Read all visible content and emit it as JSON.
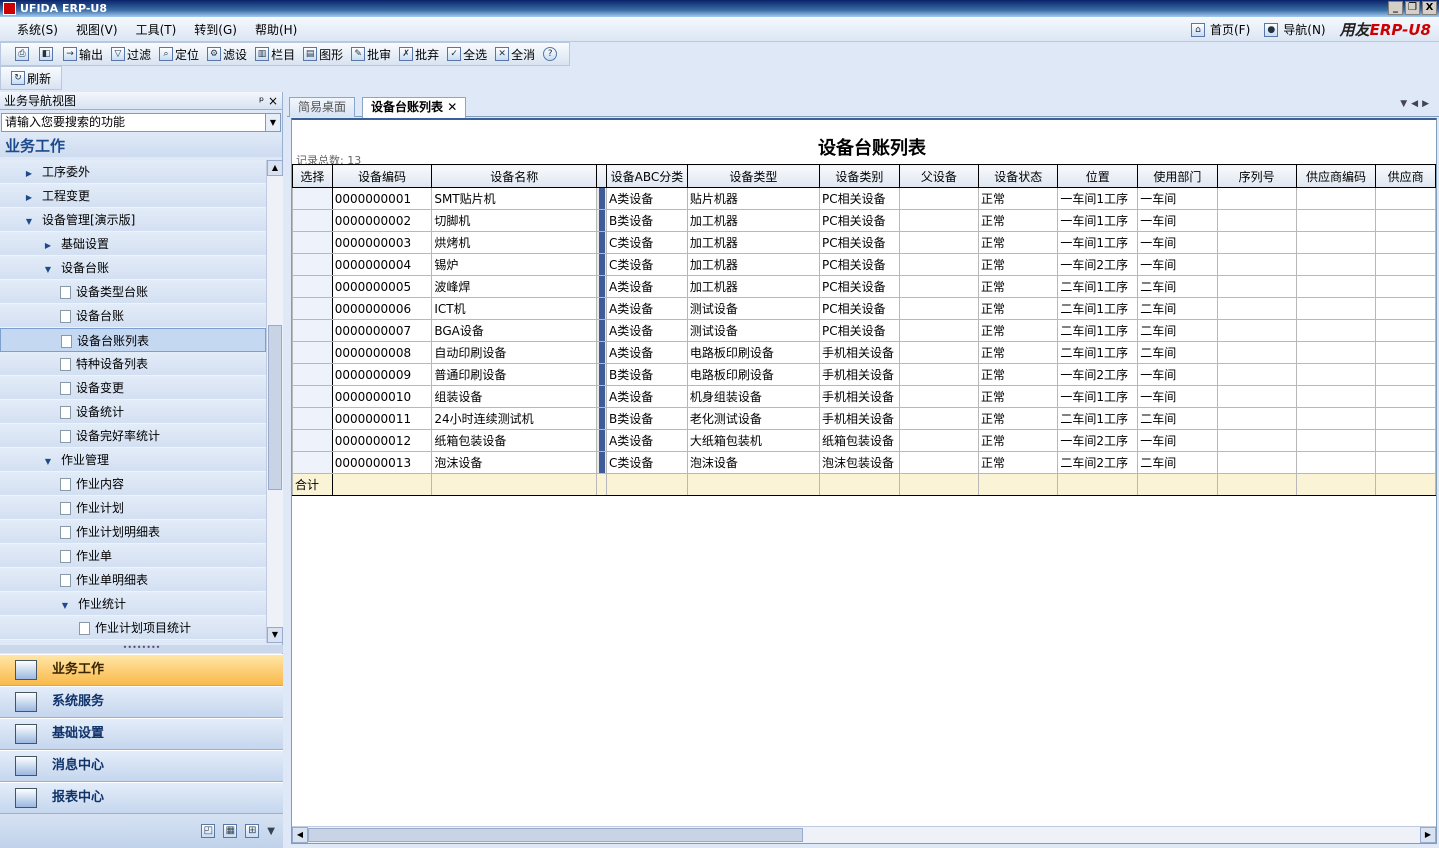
{
  "window": {
    "title": "UFIDA ERP-U8",
    "min": "_",
    "restore": "❐",
    "close": "X"
  },
  "menu": [
    "系统(S)",
    "视图(V)",
    "工具(T)",
    "转到(G)",
    "帮助(H)"
  ],
  "right_menu": {
    "home": "首页(F)",
    "nav": "导航(N)",
    "brand_prefix": "用友",
    "brand_erp": "ERP-U8"
  },
  "toolbar": [
    "输出",
    "过滤",
    "定位",
    "滤设",
    "栏目",
    "图形",
    "批审",
    "批弃",
    "全选",
    "全消"
  ],
  "toolbar2": {
    "refresh": "刷新"
  },
  "nav": {
    "header": "业务导航视图",
    "pin": "ᵖ ×",
    "search_placeholder": "请输入您要搜索的功能",
    "section": "业务工作",
    "tree": [
      {
        "label": "工序委外",
        "level": 1,
        "type": "collapsed"
      },
      {
        "label": "工程变更",
        "level": 1,
        "type": "collapsed"
      },
      {
        "label": "设备管理[演示版]",
        "level": 1,
        "type": "expanded"
      },
      {
        "label": "基础设置",
        "level": 2,
        "type": "collapsed"
      },
      {
        "label": "设备台账",
        "level": 2,
        "type": "expanded"
      },
      {
        "label": "设备类型台账",
        "level": 3,
        "type": "doc"
      },
      {
        "label": "设备台账",
        "level": 3,
        "type": "doc"
      },
      {
        "label": "设备台账列表",
        "level": 3,
        "type": "doc",
        "selected": true
      },
      {
        "label": "特种设备列表",
        "level": 3,
        "type": "doc"
      },
      {
        "label": "设备变更",
        "level": 3,
        "type": "doc"
      },
      {
        "label": "设备统计",
        "level": 3,
        "type": "doc"
      },
      {
        "label": "设备完好率统计",
        "level": 3,
        "type": "doc"
      },
      {
        "label": "作业管理",
        "level": 2,
        "type": "expanded"
      },
      {
        "label": "作业内容",
        "level": 3,
        "type": "doc"
      },
      {
        "label": "作业计划",
        "level": 3,
        "type": "doc"
      },
      {
        "label": "作业计划明细表",
        "level": 3,
        "type": "doc"
      },
      {
        "label": "作业单",
        "level": 3,
        "type": "doc"
      },
      {
        "label": "作业单明细表",
        "level": 3,
        "type": "doc"
      },
      {
        "label": "作业统计",
        "level": 3,
        "type": "expanded"
      },
      {
        "label": "作业计划项目统计",
        "level": 4,
        "type": "doc"
      }
    ],
    "bottom_buttons": [
      {
        "label": "业务工作",
        "active": true
      },
      {
        "label": "系统服务",
        "active": false
      },
      {
        "label": "基础设置",
        "active": false
      },
      {
        "label": "消息中心",
        "active": false
      },
      {
        "label": "报表中心",
        "active": false
      }
    ]
  },
  "tabs": [
    {
      "label": "简易桌面",
      "active": false
    },
    {
      "label": "设备台账列表",
      "active": true
    }
  ],
  "page": {
    "title": "设备台账列表",
    "record_count": "记录总数: 13"
  },
  "grid": {
    "columns": [
      "选择",
      "设备编码",
      "设备名称",
      "设备ABC分类",
      "设备类型",
      "设备类别",
      "父设备",
      "设备状态",
      "位置",
      "使用部门",
      "序列号",
      "供应商编码",
      "供应商"
    ],
    "rows": [
      [
        "",
        "0000000001",
        "SMT贴片机",
        "A类设备",
        "贴片机器",
        "PC相关设备",
        "",
        "正常",
        "一车间1工序",
        "一车间",
        "",
        "",
        ""
      ],
      [
        "",
        "0000000002",
        "切脚机",
        "B类设备",
        "加工机器",
        "PC相关设备",
        "",
        "正常",
        "一车间1工序",
        "一车间",
        "",
        "",
        ""
      ],
      [
        "",
        "0000000003",
        "烘烤机",
        "C类设备",
        "加工机器",
        "PC相关设备",
        "",
        "正常",
        "一车间1工序",
        "一车间",
        "",
        "",
        ""
      ],
      [
        "",
        "0000000004",
        "锡炉",
        "C类设备",
        "加工机器",
        "PC相关设备",
        "",
        "正常",
        "一车间2工序",
        "一车间",
        "",
        "",
        ""
      ],
      [
        "",
        "0000000005",
        "波峰焊",
        "A类设备",
        "加工机器",
        "PC相关设备",
        "",
        "正常",
        "二车间1工序",
        "二车间",
        "",
        "",
        ""
      ],
      [
        "",
        "0000000006",
        "ICT机",
        "A类设备",
        "测试设备",
        "PC相关设备",
        "",
        "正常",
        "二车间1工序",
        "二车间",
        "",
        "",
        ""
      ],
      [
        "",
        "0000000007",
        "BGA设备",
        "A类设备",
        "测试设备",
        "PC相关设备",
        "",
        "正常",
        "二车间1工序",
        "二车间",
        "",
        "",
        ""
      ],
      [
        "",
        "0000000008",
        "自动印刷设备",
        "A类设备",
        "电路板印刷设备",
        "手机相关设备",
        "",
        "正常",
        "二车间1工序",
        "二车间",
        "",
        "",
        ""
      ],
      [
        "",
        "0000000009",
        "普通印刷设备",
        "B类设备",
        "电路板印刷设备",
        "手机相关设备",
        "",
        "正常",
        "一车间2工序",
        "一车间",
        "",
        "",
        ""
      ],
      [
        "",
        "0000000010",
        "组装设备",
        "A类设备",
        "机身组装设备",
        "手机相关设备",
        "",
        "正常",
        "一车间1工序",
        "一车间",
        "",
        "",
        ""
      ],
      [
        "",
        "0000000011",
        "24小时连续测试机",
        "B类设备",
        "老化测试设备",
        "手机相关设备",
        "",
        "正常",
        "二车间1工序",
        "二车间",
        "",
        "",
        ""
      ],
      [
        "",
        "0000000012",
        "纸箱包装设备",
        "A类设备",
        "大纸箱包装机",
        "纸箱包装设备",
        "",
        "正常",
        "一车间2工序",
        "一车间",
        "",
        "",
        ""
      ],
      [
        "",
        "0000000013",
        "泡沫设备",
        "C类设备",
        "泡沫设备",
        "泡沫包装设备",
        "",
        "正常",
        "二车间2工序",
        "二车间",
        "",
        "",
        ""
      ]
    ],
    "total_label": "合计"
  }
}
